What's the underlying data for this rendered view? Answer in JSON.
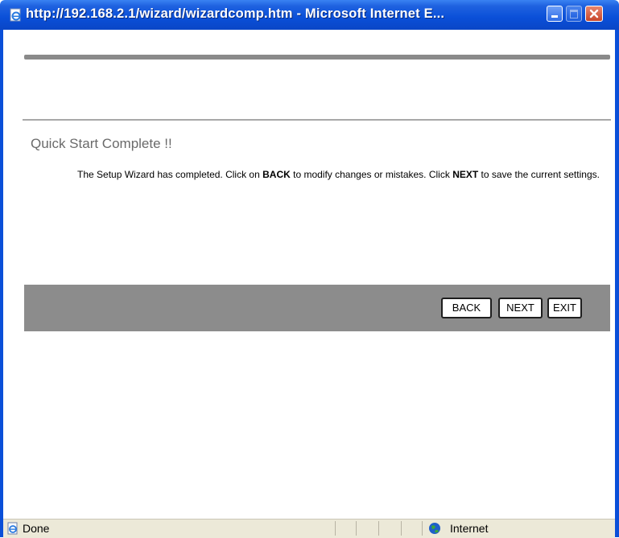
{
  "window": {
    "title": "http://192.168.2.1/wizard/wizardcomp.htm - Microsoft Internet E...",
    "title_icon": "ie-page-icon",
    "controls": [
      "minimize",
      "maximize",
      "close"
    ]
  },
  "content": {
    "heading": "Quick Start Complete !!",
    "message": {
      "part1": "The Setup Wizard has completed. Click on ",
      "bold1": "BACK",
      "part2": " to modify changes or mistakes. Click ",
      "bold2": "NEXT",
      "part3": " to save the current settings."
    }
  },
  "buttons": {
    "back": "BACK",
    "next": "NEXT",
    "exit": "EXIT"
  },
  "statusbar": {
    "status": "Done",
    "zone": "Internet"
  },
  "colors": {
    "titlebar": "#0a4fd8",
    "button_bar": "#8c8c8c",
    "heading": "#6a6a6a",
    "statusbar": "#ece9d8"
  }
}
